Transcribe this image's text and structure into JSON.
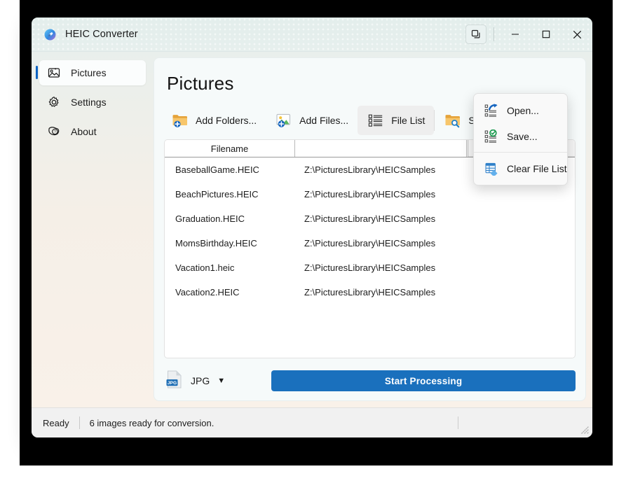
{
  "window": {
    "title": "HEIC Converter",
    "app_icon": "pill-capsule-icon",
    "controls": {
      "snap_layouts": "snap-layouts-icon",
      "minimize": "—",
      "maximize": "☐",
      "close": "✕"
    }
  },
  "sidebar": {
    "items": [
      {
        "label": "Pictures",
        "icon": "pictures-icon",
        "selected": true
      },
      {
        "label": "Settings",
        "icon": "gear-icon",
        "selected": false
      },
      {
        "label": "About",
        "icon": "help-about-icon",
        "selected": false
      }
    ]
  },
  "main": {
    "page_title": "Pictures",
    "toolbar": [
      {
        "label": "Add Folders...",
        "icon": "folder-add-icon",
        "active": false
      },
      {
        "label": "Add Files...",
        "icon": "image-add-icon",
        "active": false
      },
      {
        "label": "File List",
        "icon": "file-list-icon",
        "active": true
      },
      {
        "label": "Search",
        "icon": "folder-search-icon",
        "active": false
      }
    ],
    "file_list": {
      "columns": [
        "Filename",
        "",
        ""
      ],
      "rows": [
        {
          "filename": "BaseballGame.HEIC",
          "path": "Z:\\PicturesLibrary\\HEICSamples"
        },
        {
          "filename": "BeachPictures.HEIC",
          "path": "Z:\\PicturesLibrary\\HEICSamples"
        },
        {
          "filename": "Graduation.HEIC",
          "path": "Z:\\PicturesLibrary\\HEICSamples"
        },
        {
          "filename": "MomsBirthday.HEIC",
          "path": "Z:\\PicturesLibrary\\HEICSamples"
        },
        {
          "filename": "Vacation1.heic",
          "path": "Z:\\PicturesLibrary\\HEICSamples"
        },
        {
          "filename": "Vacation2.HEIC",
          "path": "Z:\\PicturesLibrary\\HEICSamples"
        }
      ]
    },
    "format_picker": {
      "icon": "jpg-file-icon",
      "badge": "JPG",
      "value": "JPG",
      "caret": "▼"
    },
    "start_button": "Start Processing"
  },
  "menu": {
    "items": [
      {
        "label": "Open...",
        "icon": "list-open-arrow-icon",
        "separator_after": false
      },
      {
        "label": "Save...",
        "icon": "list-save-check-icon",
        "separator_after": true
      },
      {
        "label": "Clear File List",
        "icon": "clear-file-list-icon",
        "separator_after": false
      }
    ]
  },
  "status_bar": {
    "state": "Ready",
    "message": "6 images ready for conversion."
  },
  "colors": {
    "accent": "#1a70bd",
    "selection_bar": "#0a62c2",
    "titlebar": "#e3eeec",
    "sidebar_top": "#e9efec",
    "sidebar_bottom": "#f9f1e9"
  }
}
